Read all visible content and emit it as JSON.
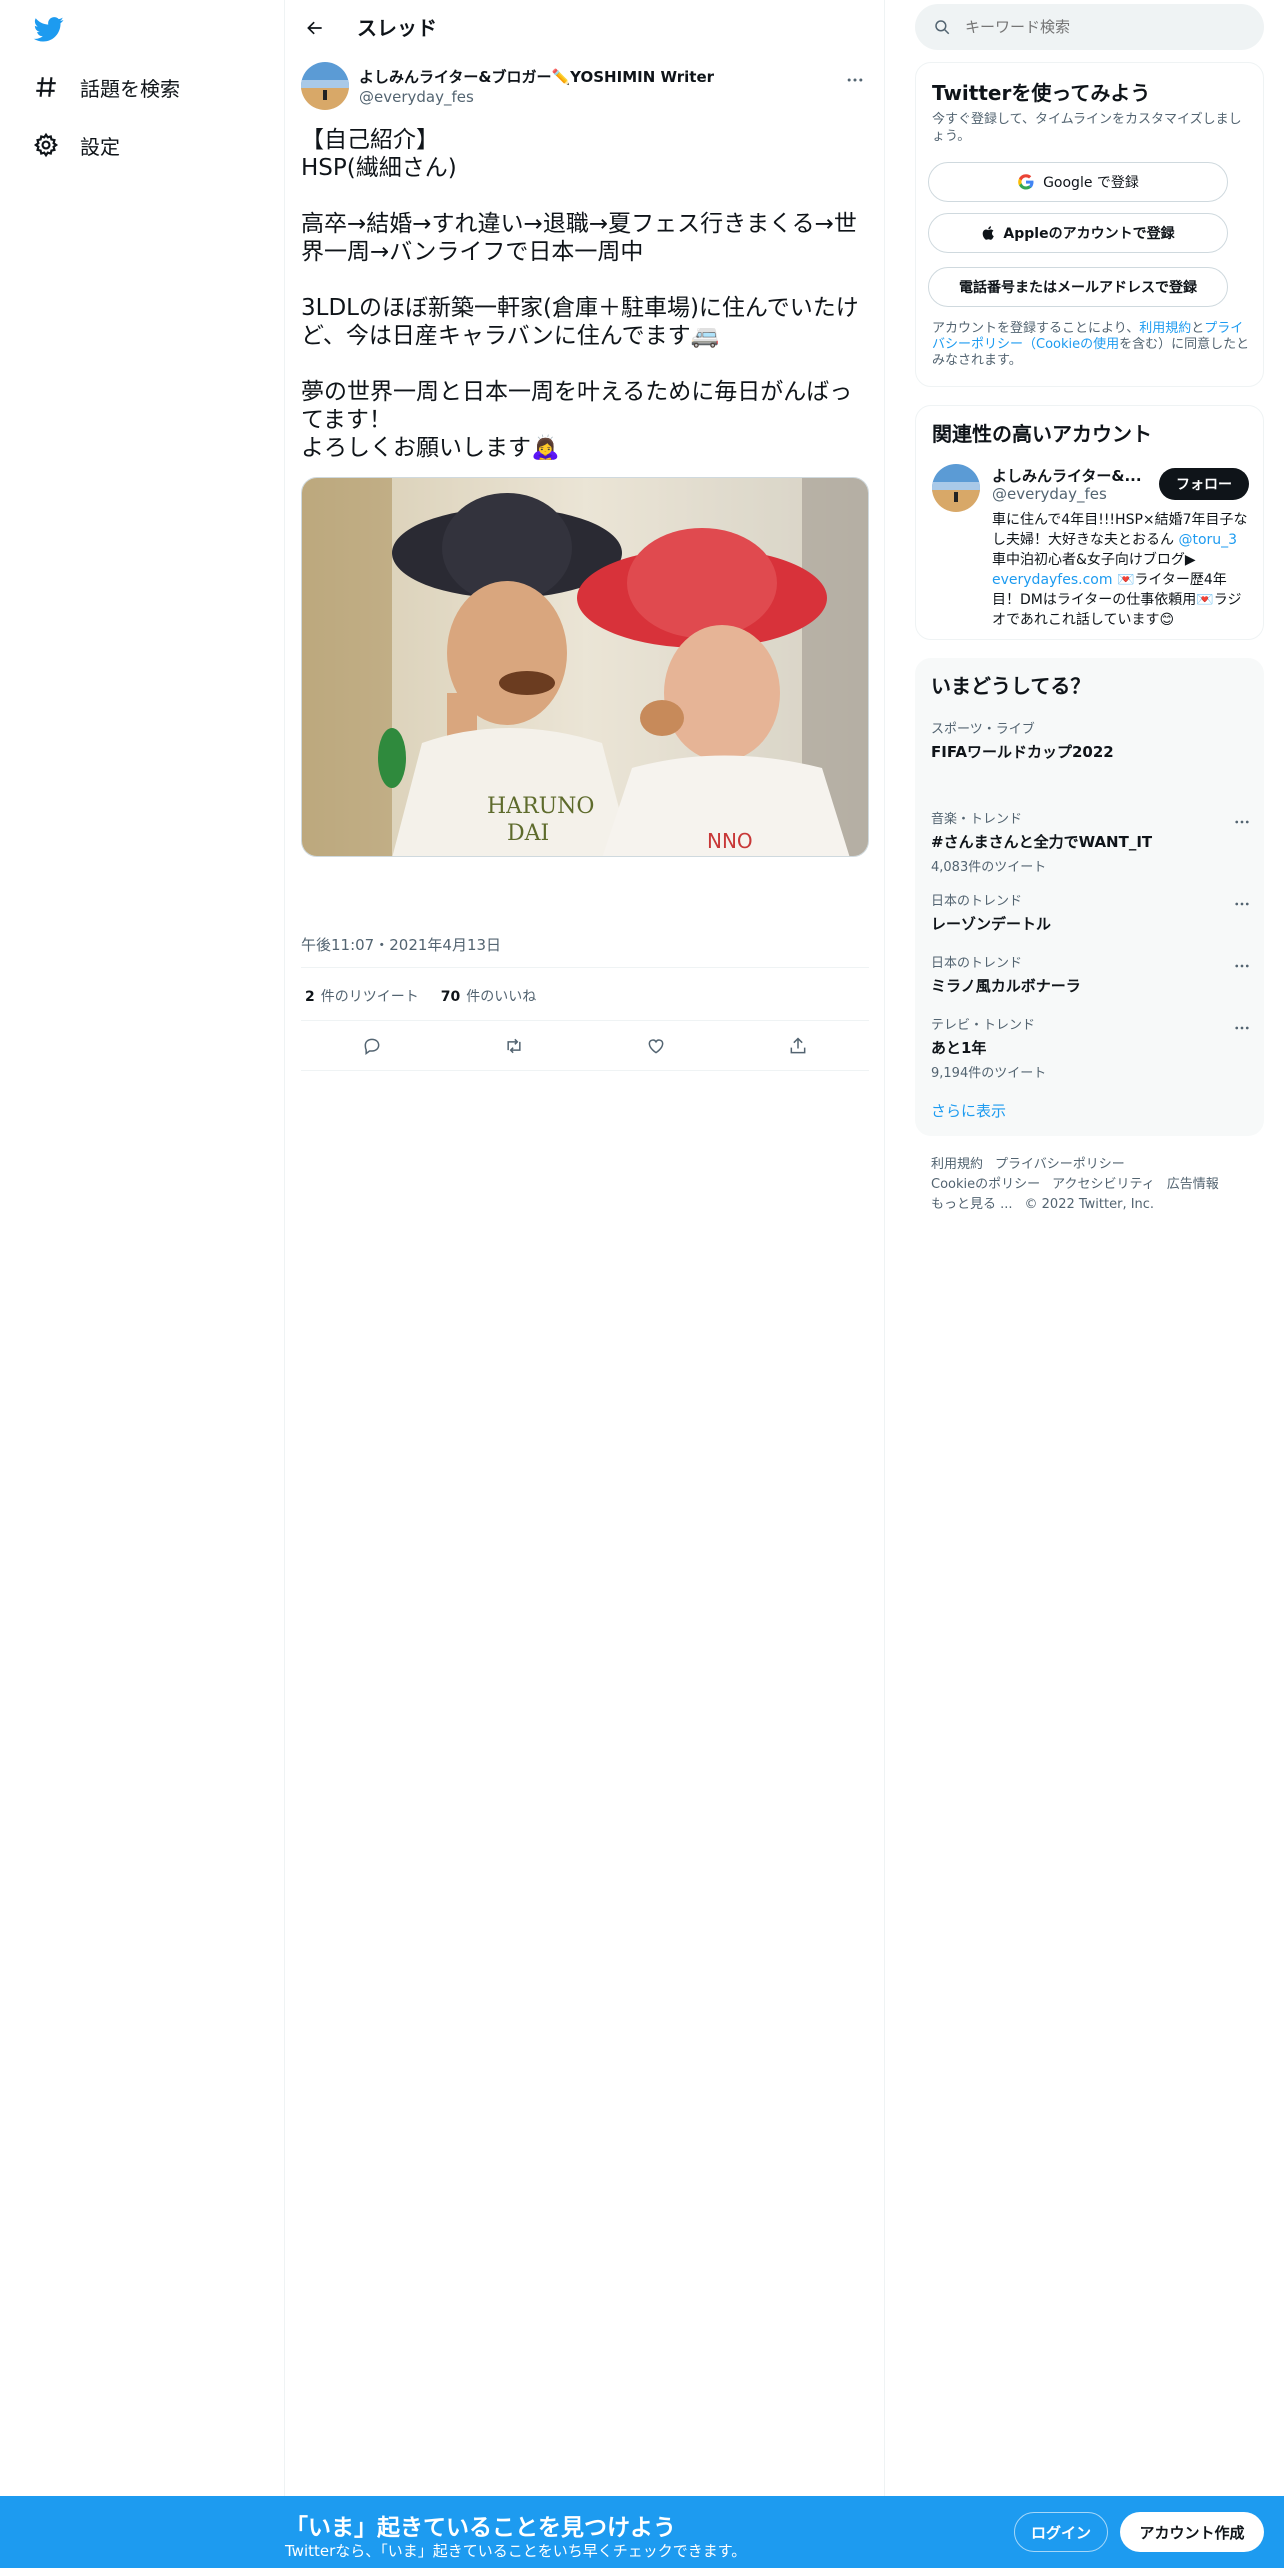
{
  "nav": {
    "items": [
      {
        "label": "話題を検索",
        "icon": "hashtag-icon"
      },
      {
        "label": "設定",
        "icon": "gear-icon"
      }
    ]
  },
  "header": {
    "title": "スレッド"
  },
  "tweet": {
    "author_name": "よしみんライター&ブロガー",
    "author_name_suffix": "YOSHIMIN Writer",
    "author_handle": "@everyday_fes",
    "text": "【自己紹介】\nHSP(繊細さん)\n\n高卒→結婚→すれ違い→退職→夏フェス行きまくる→世界一周→バンライフで日本一周中\n\n3LDLのほぼ新築一軒家(倉庫＋駐車場)に住んでいたけど、今は日産キャラバンに住んでます🚐\n\n夢の世界一周と日本一周を叶えるために毎日がんばってます！\nよろしくお願いします🙇‍♀️",
    "time": "午後11:07・2021年4月13日",
    "retweet_count": "2",
    "retweet_label": "件のリツイート",
    "like_count": "70",
    "like_label": "件のいいね"
  },
  "search": {
    "placeholder": "キーワード検索"
  },
  "signup": {
    "title": "Twitterを使ってみよう",
    "subtitle": "今すぐ登録して、タイムラインをカスタマイズしましょう。",
    "google_label": "Google で登録",
    "apple_label": "Appleのアカウントで登録",
    "phone_label": "電話番号またはメールアドレスで登録",
    "legal_prefix": "アカウントを登録することにより、",
    "legal_terms": "利用規約",
    "legal_and": "と",
    "legal_privacy": "プライバシーポリシー（Cookieの使用",
    "legal_suffix": "を含む）に同意したとみなされます。"
  },
  "relevant": {
    "title": "関連性の高いアカウント",
    "name": "よしみんライター&...",
    "handle": "@everyday_fes",
    "follow_label": "フォロー",
    "bio_part1": "車に住んで4年目!!!HSP×結婚7年目子なし夫婦！大好きな夫とおるん ",
    "bio_mention": "@toru_3",
    "bio_part2": " 車中泊初心者&女子向けブログ▶ ",
    "bio_link": "everydayfes.com",
    "bio_part3": " 💌ライター歴4年目！DMはライターの仕事依頼用💌ラジオであれこれ話しています😊"
  },
  "trends": {
    "title": "いまどうしてる？",
    "items": [
      {
        "category": "スポーツ・ライブ",
        "name": "FIFAワールドカップ2022",
        "count": ""
      },
      {
        "category": "音楽・トレンド",
        "name": "#さんまさんと全力でWANT_IT",
        "count": "4,083件のツイート"
      },
      {
        "category": "日本のトレンド",
        "name": "レーゾンデートル",
        "count": ""
      },
      {
        "category": "日本のトレンド",
        "name": "ミラノ風カルボナーラ",
        "count": ""
      },
      {
        "category": "テレビ・トレンド",
        "name": "あと1年",
        "count": "9,194件のツイート"
      }
    ],
    "show_more": "さらに表示"
  },
  "footer": {
    "links": [
      "利用規約",
      "プライバシーポリシー",
      "Cookieのポリシー",
      "アクセシビリティ",
      "広告情報",
      "もっと見る ...",
      "© 2022 Twitter, Inc."
    ]
  },
  "bottom_bar": {
    "title": "「いま」起きていることを見つけよう",
    "subtitle": "Twitterなら、「いま」起きていることをいち早くチェックできます。",
    "login_label": "ログイン",
    "signup_label": "アカウント作成"
  },
  "colors": {
    "accent": "#1d9bf0",
    "text": "#0f1419",
    "muted": "#536471"
  }
}
